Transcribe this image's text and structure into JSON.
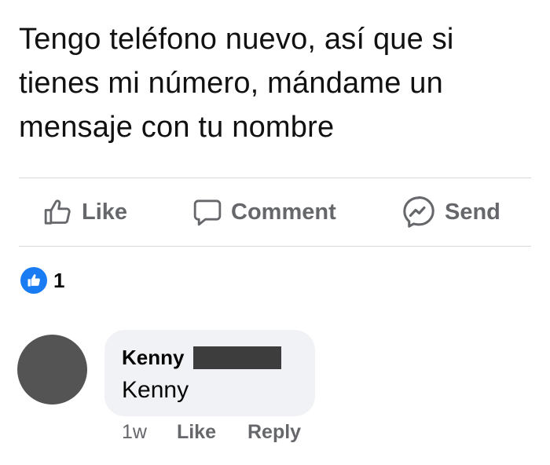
{
  "post": {
    "text": "Tengo teléfono nuevo, así que si tienes mi número, mándame un mensaje con tu nombre"
  },
  "actions": {
    "like_label": "Like",
    "comment_label": "Comment",
    "send_label": "Send"
  },
  "reactions": {
    "count": "1"
  },
  "comment": {
    "author": "Kenny",
    "text": "Kenny",
    "time": "1w",
    "like_label": "Like",
    "reply_label": "Reply"
  },
  "colors": {
    "action_gray": "#65676b",
    "like_blue": "#1a7cf2",
    "bubble_bg": "#f0f2f5",
    "avatar": "#545454",
    "redaction": "#3d3d3d"
  },
  "icons": {
    "like": "thumbs-up-icon",
    "comment": "speech-bubble-icon",
    "send": "messenger-icon",
    "reaction": "like-reaction-icon"
  }
}
